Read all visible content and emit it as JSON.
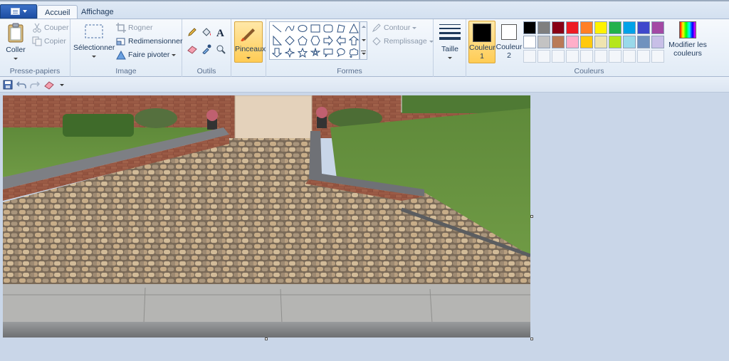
{
  "tabs": {
    "home": "Accueil",
    "view": "Affichage"
  },
  "clipboard": {
    "paste": "Coller",
    "cut": "Couper",
    "copy": "Copier",
    "label": "Presse-papiers"
  },
  "image": {
    "select": "Sélectionner",
    "crop": "Rogner",
    "resize": "Redimensionner",
    "rotate": "Faire pivoter",
    "label": "Image"
  },
  "tools": {
    "label": "Outils"
  },
  "brushes": {
    "label": "Pinceaux"
  },
  "shapes": {
    "outline": "Contour",
    "fill": "Remplissage",
    "label": "Formes"
  },
  "size": {
    "label": "Taille"
  },
  "colors": {
    "color1_line1": "Couleur",
    "color1_line2": "1",
    "color2_line1": "Couleur",
    "color2_line2": "2",
    "edit_line1": "Modifier les",
    "edit_line2": "couleurs",
    "label": "Couleurs",
    "color1": "#000000",
    "color2": "#ffffff",
    "palette_row1": [
      "#000000",
      "#7f7f7f",
      "#880015",
      "#ed1c24",
      "#ff7f27",
      "#fff200",
      "#22b14c",
      "#00a2e8",
      "#3f48cc",
      "#a349a4"
    ],
    "palette_row2": [
      "#ffffff",
      "#c3c3c3",
      "#b97a57",
      "#ffaec9",
      "#ffc90e",
      "#efe4b0",
      "#b5e61d",
      "#99d9ea",
      "#7092be",
      "#c8bfe7"
    ]
  }
}
